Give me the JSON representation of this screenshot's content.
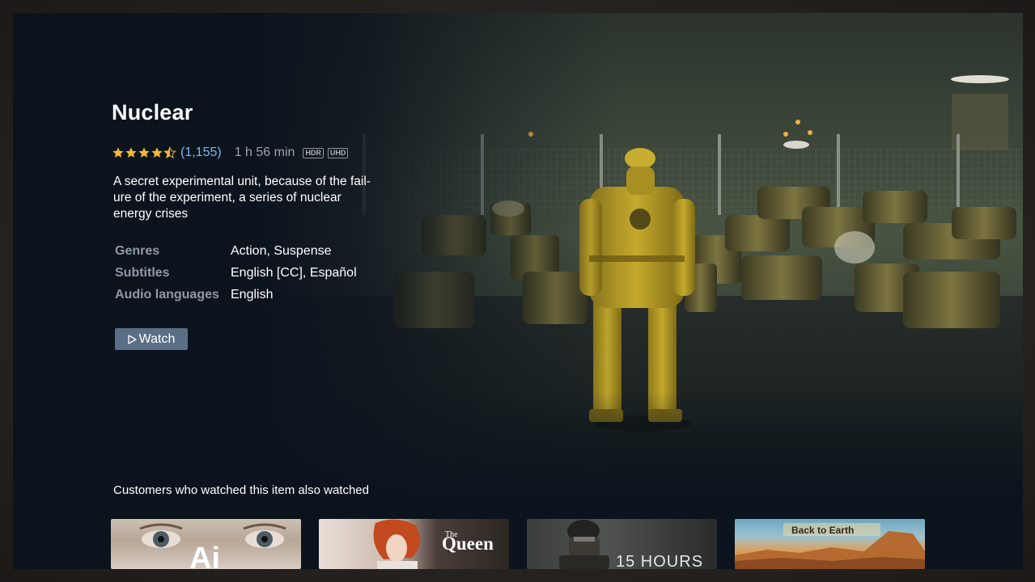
{
  "movie": {
    "title": "Nuclear",
    "rating_stars": 4.5,
    "rating_count": "(1,155)",
    "duration": "1 h 56 min",
    "badges": [
      "HDR",
      "UHD"
    ],
    "synopsis_line1": "A secret experimental unit, because of the fail-",
    "synopsis_line2": "ure of the experiment, a series of nuclear",
    "synopsis_line3": "energy crises",
    "details": [
      {
        "key": "Genres",
        "value": "Action, Suspense"
      },
      {
        "key": "Subtitles",
        "value": "English [CC], Español"
      },
      {
        "key": "Audio languages",
        "value": "English"
      }
    ],
    "watch_label": "Watch"
  },
  "recommendations": {
    "heading": "Customers who watched this item also watched",
    "items": [
      {
        "title": "Ai",
        "subtitle": ""
      },
      {
        "title": "Queen",
        "subtitle": "The"
      },
      {
        "title": "15 HOURS",
        "subtitle": ""
      },
      {
        "title": "Back to Earth",
        "subtitle": ""
      }
    ]
  },
  "colors": {
    "background": "#0b141d",
    "accent_link": "#79b8f3",
    "star": "#f5b731",
    "button": "#5a6f86"
  }
}
